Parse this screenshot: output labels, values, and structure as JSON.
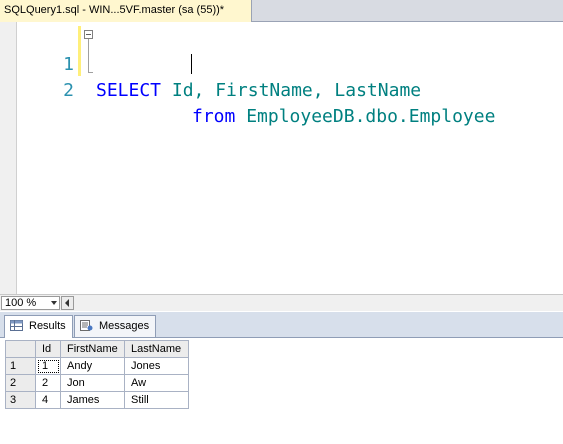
{
  "tab": {
    "title": "SQLQuery1.sql - WIN...5VF.master (sa (55))*"
  },
  "editor": {
    "lines": [
      {
        "num": "1",
        "kw": "SELECT",
        "rest": " Id, FirstName, LastName"
      },
      {
        "num": "2",
        "kw": "from",
        "rest": " EmployeeDB.dbo.Employee"
      }
    ]
  },
  "zoom": {
    "value": "100 %"
  },
  "results": {
    "tabs": [
      {
        "label": "Results",
        "icon": "grid-icon"
      },
      {
        "label": "Messages",
        "icon": "messages-icon"
      }
    ],
    "columns": [
      "Id",
      "FirstName",
      "LastName"
    ],
    "rows": [
      {
        "rownum": "1",
        "cells": [
          "1",
          "Andy",
          "Jones"
        ]
      },
      {
        "rownum": "2",
        "cells": [
          "2",
          "Jon",
          "Aw"
        ]
      },
      {
        "rownum": "3",
        "cells": [
          "4",
          "James",
          "Still"
        ]
      }
    ]
  },
  "colors": {
    "keyword": "#0000ff",
    "identifier": "#008080",
    "line_number": "#2b91af",
    "modified_tab": "#fff7cf"
  }
}
